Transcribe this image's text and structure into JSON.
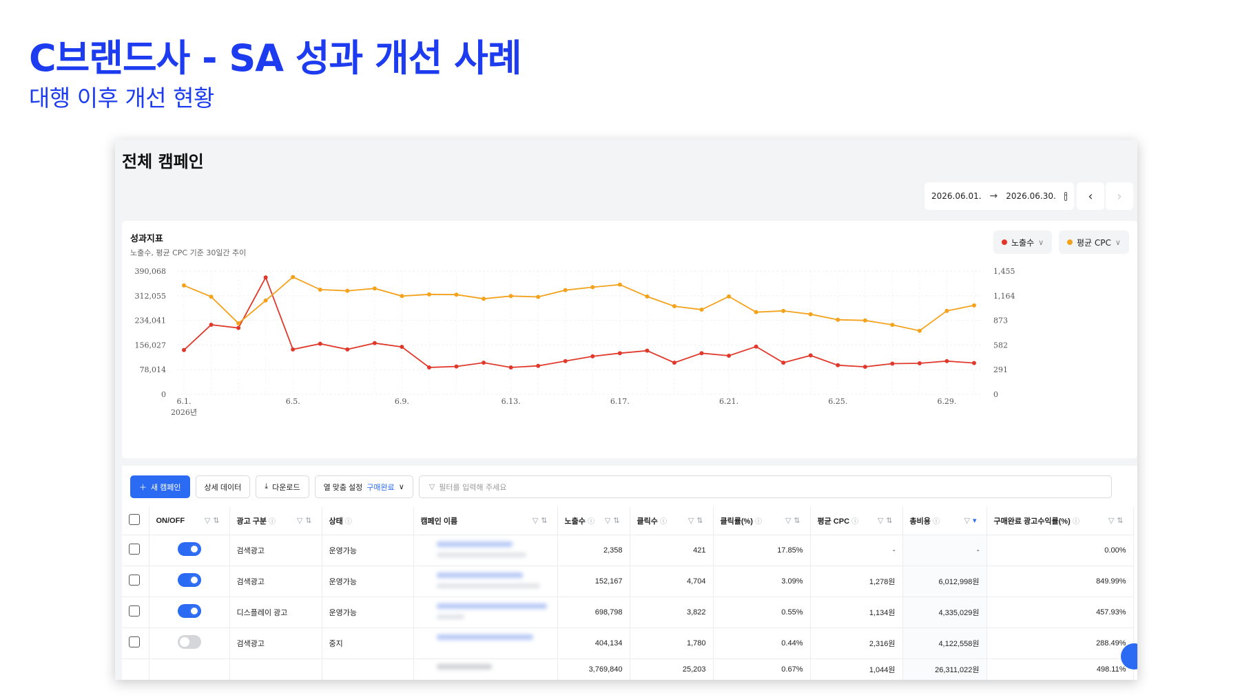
{
  "slide": {
    "title": "C브랜드사 - SA 성과 개선 사례",
    "subtitle": "대행 이후 개선 현황"
  },
  "page": {
    "title": "전체 캠페인",
    "date_start": "2026.06.01.",
    "date_end": "2026.06.30.",
    "prev_icon": "chevron-left-icon",
    "next_icon": "chevron-right-icon"
  },
  "chart_card": {
    "title": "성과지표",
    "subtitle": "노출수, 평균 CPC 기준 30일간 추이",
    "legend": [
      {
        "label": "노출수",
        "color": "#e0392b"
      },
      {
        "label": "평균 CPC",
        "color": "#f4a21b"
      }
    ]
  },
  "chart_data": {
    "type": "line",
    "x": [
      "6.1.",
      "6.2.",
      "6.3.",
      "6.4.",
      "6.5.",
      "6.6.",
      "6.7.",
      "6.8.",
      "6.9.",
      "6.10.",
      "6.11.",
      "6.12.",
      "6.13.",
      "6.14.",
      "6.15.",
      "6.16.",
      "6.17.",
      "6.18.",
      "6.19.",
      "6.20.",
      "6.21.",
      "6.22.",
      "6.23.",
      "6.24.",
      "6.25.",
      "6.26.",
      "6.27.",
      "6.28.",
      "6.29.",
      "6.30."
    ],
    "x_tick_labels": [
      "6.1.",
      "6.5.",
      "6.9.",
      "6.13.",
      "6.17.",
      "6.21.",
      "6.25.",
      "6.29."
    ],
    "x_year_label": "2026년",
    "left_axis_ticks": [
      "390,068",
      "312,055",
      "234,041",
      "156,027",
      "78,014",
      "0"
    ],
    "right_axis_ticks": [
      "1,455",
      "1,164",
      "873",
      "582",
      "291",
      "0"
    ],
    "ylim_left": [
      0,
      390068
    ],
    "ylim_right": [
      0,
      1455
    ],
    "grid": true,
    "series": [
      {
        "name": "노출수",
        "axis": "left",
        "color": "#e0392b",
        "values": [
          140000,
          220000,
          210000,
          370000,
          142000,
          160000,
          142000,
          162000,
          150000,
          85000,
          88000,
          100000,
          85000,
          90000,
          105000,
          120000,
          130000,
          138000,
          100000,
          130000,
          122000,
          151000,
          100000,
          123000,
          92000,
          87000,
          97000,
          98000,
          105000,
          99000
        ]
      },
      {
        "name": "평균 CPC",
        "axis": "right",
        "color": "#f4a21b",
        "values": [
          1285,
          1152,
          838,
          1107,
          1385,
          1236,
          1222,
          1250,
          1160,
          1180,
          1177,
          1128,
          1160,
          1150,
          1230,
          1265,
          1295,
          1155,
          1040,
          1000,
          1155,
          970,
          985,
          945,
          880,
          872,
          820,
          750,
          985,
          1050
        ]
      }
    ]
  },
  "toolbar": {
    "new_campaign": "새 캠페인",
    "detail_data": "상세 데이터",
    "download": "다운로드",
    "column_setting": "열 맞춤 설정",
    "column_setting_value": "구매완료",
    "filter_placeholder": "필터를 입력해 주세요"
  },
  "table": {
    "headers": {
      "onoff": "ON/OFF",
      "ad_type": "광고 구분",
      "status": "상태",
      "campaign": "캠페인 이름",
      "impressions": "노출수",
      "clicks": "클릭수",
      "ctr": "클릭률(%)",
      "cpc": "평균 CPC",
      "cost": "총비용",
      "roas": "구매완료 광고수익률(%)"
    },
    "rows": [
      {
        "on": true,
        "ad_type": "검색광고",
        "status": "운영가능",
        "impressions": "2,358",
        "clicks": "421",
        "ctr": "17.85%",
        "cpc": "-",
        "cost": "-",
        "roas": "0.00%"
      },
      {
        "on": true,
        "ad_type": "검색광고",
        "status": "운영가능",
        "impressions": "152,167",
        "clicks": "4,704",
        "ctr": "3.09%",
        "cpc": "1,278원",
        "cost": "6,012,998원",
        "roas": "849.99%"
      },
      {
        "on": true,
        "ad_type": "디스플레이 광고",
        "status": "운영가능",
        "impressions": "698,798",
        "clicks": "3,822",
        "ctr": "0.55%",
        "cpc": "1,134원",
        "cost": "4,335,029원",
        "roas": "457.93%"
      },
      {
        "on": false,
        "ad_type": "검색광고",
        "status": "중지",
        "impressions": "404,134",
        "clicks": "1,780",
        "ctr": "0.44%",
        "cpc": "2,316원",
        "cost": "4,122,558원",
        "roas": "288.49%"
      }
    ],
    "total": {
      "impressions": "3,769,840",
      "clicks": "25,203",
      "ctr": "0.67%",
      "cpc": "1,044원",
      "cost": "26,311,022원",
      "roas": "498.11%"
    }
  }
}
